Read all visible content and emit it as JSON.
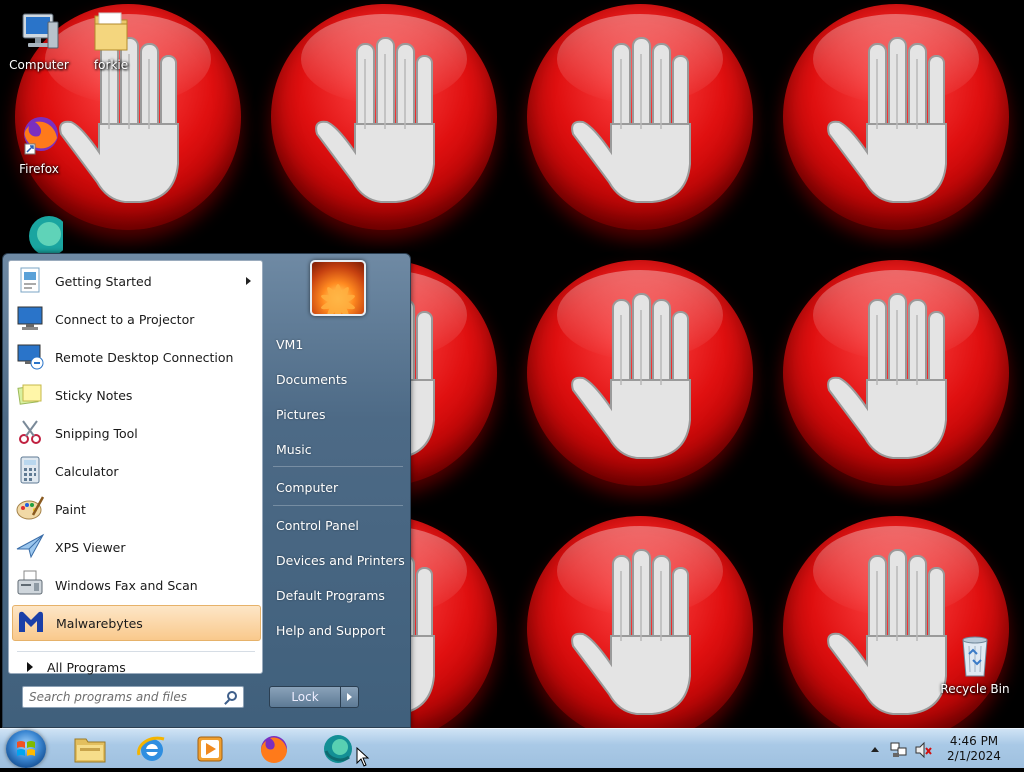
{
  "desktop": {
    "icons": [
      {
        "label": "Computer"
      },
      {
        "label": "forkie"
      },
      {
        "label": "Firefox"
      },
      {
        "label": ""
      },
      {
        "label": "Recycle Bin"
      }
    ]
  },
  "start_menu": {
    "programs": [
      {
        "label": "Getting Started",
        "icon": "getting-started-icon"
      },
      {
        "label": "Connect to a Projector",
        "icon": "projector-icon"
      },
      {
        "label": "Remote Desktop Connection",
        "icon": "remote-desktop-icon"
      },
      {
        "label": "Sticky Notes",
        "icon": "sticky-notes-icon"
      },
      {
        "label": "Snipping Tool",
        "icon": "scissors-icon"
      },
      {
        "label": "Calculator",
        "icon": "calculator-icon"
      },
      {
        "label": "Paint",
        "icon": "paint-palette-icon"
      },
      {
        "label": "XPS Viewer",
        "icon": "xps-viewer-icon"
      },
      {
        "label": "Windows Fax and Scan",
        "icon": "fax-icon"
      },
      {
        "label": "Malwarebytes",
        "icon": "malwarebytes-icon"
      }
    ],
    "all_programs": "All Programs",
    "search_placeholder": "Search programs and files",
    "right_items": [
      "VM1",
      "Documents",
      "Pictures",
      "Music",
      "Computer",
      "Control Panel",
      "Devices and Printers",
      "Default Programs",
      "Help and Support"
    ],
    "lock_label": "Lock"
  },
  "taskbar": {
    "pinned": [
      "explorer-icon",
      "internet-explorer-icon",
      "media-player-icon",
      "firefox-icon",
      "edge-icon"
    ],
    "clock_time": "4:46 PM",
    "clock_date": "2/1/2024"
  }
}
